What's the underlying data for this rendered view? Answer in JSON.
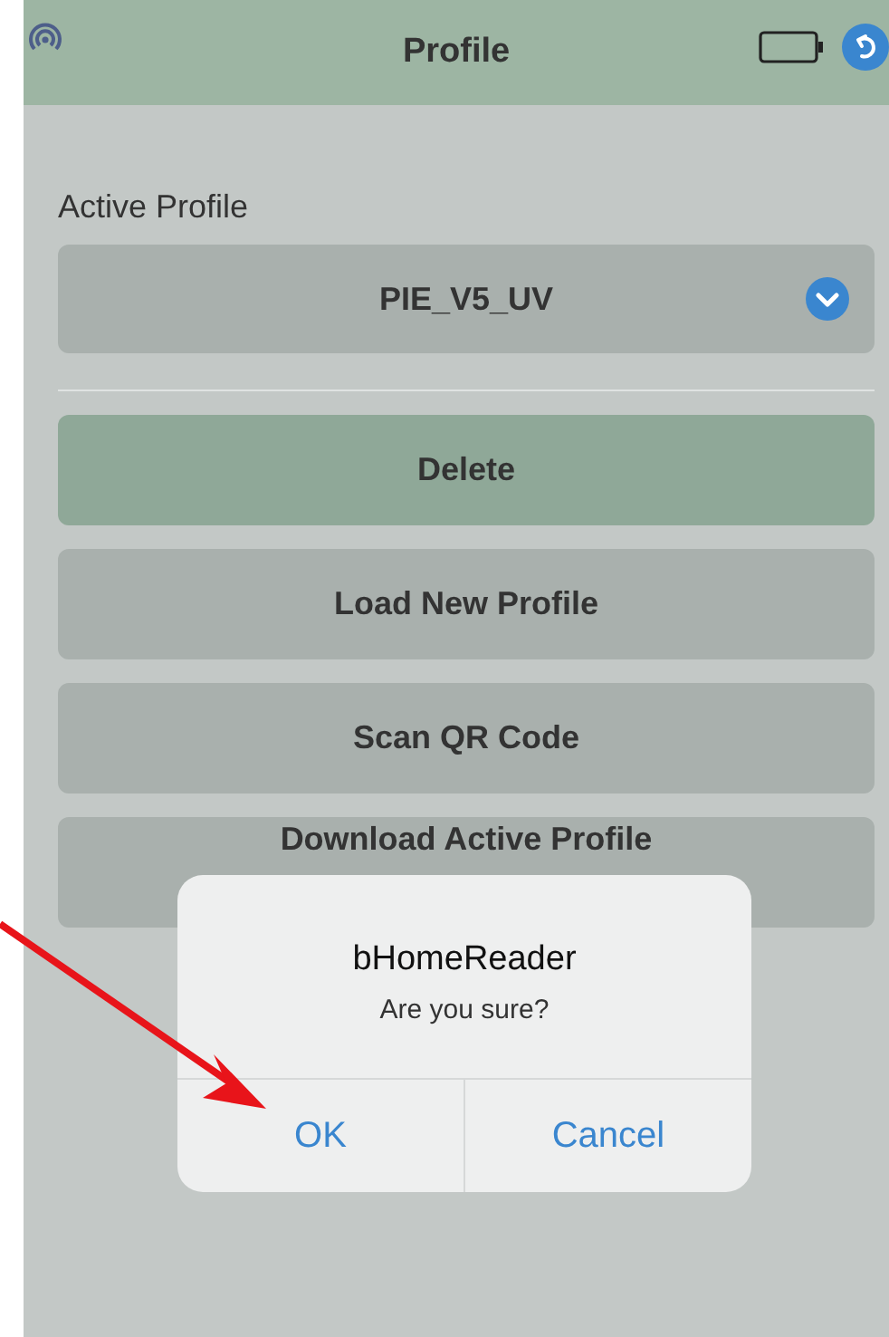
{
  "header": {
    "title": "Profile"
  },
  "active_profile": {
    "label": "Active Profile",
    "value": "PIE_V5_UV"
  },
  "buttons": [
    {
      "label": "Delete",
      "highlighted": true
    },
    {
      "label": "Load New Profile",
      "highlighted": false
    },
    {
      "label": "Scan QR Code",
      "highlighted": false
    },
    {
      "label": "Download Active Profile",
      "highlighted": false
    }
  ],
  "dialog": {
    "title": "bHomeReader",
    "message": "Are you sure?",
    "buttons": [
      "OK",
      "Cancel"
    ]
  }
}
